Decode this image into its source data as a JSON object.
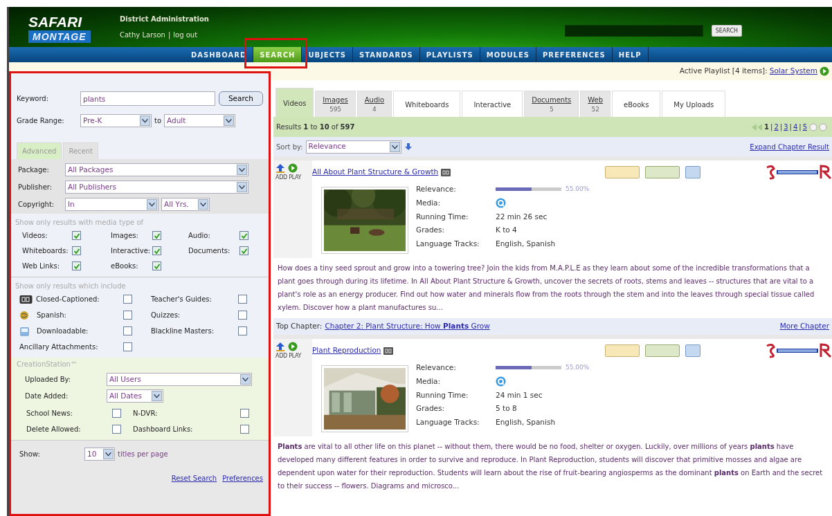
{
  "header": {
    "logo_top": "SAFARI",
    "logo_bottom": "MONTAGE",
    "account": "District Administration",
    "user": "Cathy Larson",
    "separator": "|",
    "logout": "log out",
    "search_button": "SEARCH"
  },
  "nav": [
    {
      "label": "DASHBOARD",
      "selected": false,
      "highlighted": false
    },
    {
      "label": "SEARCH",
      "selected": true,
      "highlighted": true
    },
    {
      "label": "UBJECTS",
      "selected": false,
      "highlighted": false
    },
    {
      "label": "STANDARDS",
      "selected": false,
      "highlighted": false
    },
    {
      "label": "PLAYLISTS",
      "selected": false,
      "highlighted": false
    },
    {
      "label": "MODULES",
      "selected": false,
      "highlighted": false
    },
    {
      "label": "PREFERENCES",
      "selected": false,
      "highlighted": false
    },
    {
      "label": "HELP",
      "selected": false,
      "highlighted": false
    }
  ],
  "playlist": {
    "label": "Active Playlist",
    "count": "[4 items]:",
    "name": "Solar System"
  },
  "filters": {
    "highlighted": true,
    "keyword": {
      "label": "Keyword:",
      "value": "plants",
      "button": "Search"
    },
    "grade": {
      "label": "Grade Range:",
      "from": "Pre-K",
      "to_label": "to",
      "to": "Adult"
    },
    "tabs": [
      {
        "label": "Advanced",
        "selected": true
      },
      {
        "label": "Recent",
        "selected": false
      }
    ],
    "package": {
      "label": "Package:",
      "value": "All Packages"
    },
    "publisher": {
      "label": "Publisher:",
      "value": "All Publishers"
    },
    "copyright": {
      "label": "Copyright:",
      "value": "In",
      "years": "All Yrs."
    },
    "media_heading": "Show only results with media type of",
    "media": [
      {
        "label": "Videos:",
        "checked": true
      },
      {
        "label": "Images:",
        "checked": true
      },
      {
        "label": "Audio:",
        "checked": true
      },
      {
        "label": "Whiteboards:",
        "checked": true
      },
      {
        "label": "Interactive:",
        "checked": true
      },
      {
        "label": "Documents:",
        "checked": true
      },
      {
        "label": "Web Links:",
        "checked": true
      },
      {
        "label": "eBooks:",
        "checked": true
      }
    ],
    "include_heading": "Show only results which include",
    "include": [
      {
        "label": "Closed-Captioned:",
        "checked": false,
        "kind": "cc"
      },
      {
        "label": "Teacher's Guides:",
        "checked": false,
        "kind": "plain"
      },
      {
        "label": "Spanish:",
        "checked": false,
        "kind": "spanish"
      },
      {
        "label": "Quizzes:",
        "checked": false,
        "kind": "plain"
      },
      {
        "label": "Downloadable:",
        "checked": false,
        "kind": "download"
      },
      {
        "label": "Blackline Masters:",
        "checked": false,
        "kind": "plain"
      },
      {
        "label": "Ancillary Attachments:",
        "checked": false,
        "kind": "plain"
      }
    ],
    "creation_heading": "CreationStation™",
    "uploaded_by": {
      "label": "Uploaded By:",
      "value": "All Users"
    },
    "date_added": {
      "label": "Date Added:",
      "value": "All Dates"
    },
    "creation": [
      {
        "label": "School News:",
        "checked": false
      },
      {
        "label": "N-DVR:",
        "checked": false
      },
      {
        "label": "Delete Allowed:",
        "checked": false
      },
      {
        "label": "Dashboard Links:",
        "checked": false
      }
    ],
    "show": {
      "label": "Show:",
      "value": "10",
      "suffix": "titles per page"
    },
    "links": [
      "Reset Search",
      "Preferences"
    ]
  },
  "media_tabs": [
    {
      "label": "Videos",
      "selected": true
    },
    {
      "label": "Images",
      "count": "595",
      "selected": false
    },
    {
      "label": "Audio",
      "count": "4",
      "selected": false
    },
    {
      "label": "Whiteboards",
      "selected": false
    },
    {
      "label": "Interactive",
      "selected": false
    },
    {
      "label": "Documents",
      "count": "5",
      "selected": false
    },
    {
      "label": "Web",
      "count": "52",
      "selected": false
    },
    {
      "label": "eBooks",
      "selected": false
    },
    {
      "label": "My Uploads",
      "selected": false
    }
  ],
  "results_summary": "Results **1** to **10** of **597**",
  "page_separator": "|",
  "pages": [
    {
      "label": "1",
      "selected": true
    },
    {
      "label": "2",
      "selected": false
    },
    {
      "label": "3",
      "selected": false
    },
    {
      "label": "4",
      "selected": false
    },
    {
      "label": "5",
      "selected": false
    }
  ],
  "sort": {
    "label": "Sort by:",
    "value": "Relevance"
  },
  "expand_link": "Expand Chapter Result",
  "results": [
    {
      "title": "All About Plant Structure & Growth",
      "add_play": "ADD PLAY",
      "relevance": {
        "label": "Relevance:",
        "level": 0.55,
        "reading": "55.00%"
      },
      "media_label": "Media:",
      "fields": [
        {
          "label": "Running Time:",
          "value": "22 min 26 sec"
        },
        {
          "label": "Grades:",
          "value": "K to 4"
        },
        {
          "label": "Language Tracks:",
          "value": "English, Spanish"
        }
      ],
      "description": "How does a tiny seed sprout and grow into a towering tree? Join the kids from M.A.P.L.E as they learn about some of the incredible transformations that a plant goes through during its lifetime. In All About Plant Structure & Growth, uncover the secrets of roots, stems and leaves -- structures that are vital to a plant's role as an energy producer. Find out how water and minerals flow from the roots through the stem and into the leaves through special tissue called xylem. Discover how a plant manufactures su...",
      "top_chapter": {
        "label": "Top Chapter:",
        "link": "Chapter 2: Plant Structure: How **Plants** Grow",
        "more": "More Chapter"
      }
    },
    {
      "title": "Plant Reproduction",
      "add_play": "ADD PLAY",
      "relevance": {
        "label": "Relevance:",
        "level": 0.55,
        "reading": "55.00%"
      },
      "media_label": "Media:",
      "fields": [
        {
          "label": "Running Time:",
          "value": "24 min 1 sec"
        },
        {
          "label": "Grades:",
          "value": "5 to 8"
        },
        {
          "label": "Language Tracks:",
          "value": "English, Spanish"
        }
      ],
      "description": "**Plants** are vital to all other life on this planet -- without them, there would be no food, shelter or oxygen. Luckily, over millions of years **plants** have developed many different features in order to survive and reproduce. In Plant Reproduction, students will discover that primitive mosses and algae are dependent upon water for their reproduction. Students will learn about the rise of fruit-bearing angiosperms as the dominant **plants** on Earth and the secret to their success -- flowers. Diagrams and microsco..."
    }
  ]
}
